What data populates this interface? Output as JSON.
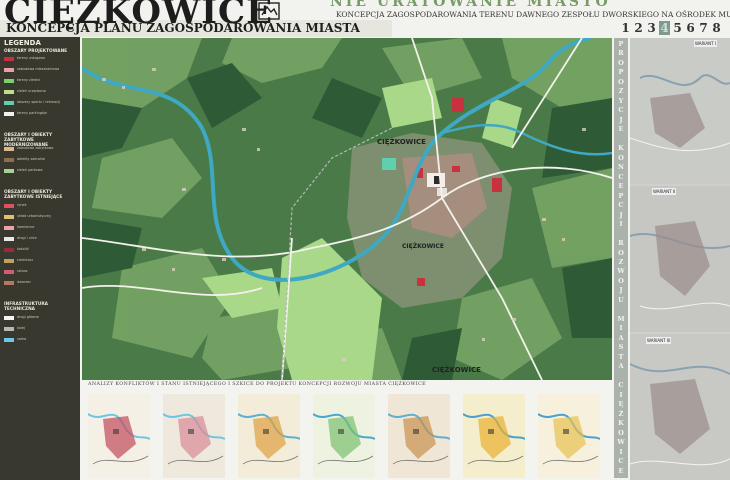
{
  "header": {
    "title": "CIĘŻKOWICE",
    "top_banner": "NIE URATOWANIE MIASTO",
    "concept": "KONCEPCJA ZAGOSPODAROWANIA TERENU DAWNEGO ZESPOŁU DWORSKIEGO NA OŚRODEK MUZYKI",
    "subtitle": "KONCEPCJA PLANU ZAGOSPODAROWANIA MIASTA",
    "pages": [
      "1",
      "2",
      "3",
      "4",
      "5",
      "6",
      "7",
      "8"
    ],
    "active_page": "4"
  },
  "legend": {
    "title": "LEGENDA",
    "sections": [
      {
        "label": "OBSZARY PROJEKTOWANE",
        "rows": [
          {
            "color": "#c8313f",
            "text": "tereny usługowe"
          },
          {
            "color": "#e8a0a8",
            "text": "zabudowa mieszkaniowa"
          },
          {
            "color": "#7bd06e",
            "text": "tereny zieleni"
          },
          {
            "color": "#b9e08f",
            "text": "zieleń urządzona"
          },
          {
            "color": "#5fcfae",
            "text": "obszary sportu i rekreacji"
          },
          {
            "color": "#f0f0f0",
            "text": "tereny parkingów"
          }
        ]
      },
      {
        "label": "OBSZARY I OBIEKTY ZABYTKOWE MODERNIZOWANE",
        "rows": [
          {
            "color": "#d9b98a",
            "text": "zabudowa zabytkowa"
          },
          {
            "color": "#8c6f4f",
            "text": "obiekty sakralne"
          },
          {
            "color": "#a8d090",
            "text": "zieleń parkowa"
          }
        ]
      },
      {
        "label": "OBSZARY I OBIEKTY ZABYTKOWE ISTNIEJĄCE",
        "rows": [
          {
            "color": "#e05060",
            "text": "rynek"
          },
          {
            "color": "#e0c070",
            "text": "układ urbanistyczny"
          },
          {
            "color": "#f0a0a8",
            "text": "kamienice"
          },
          {
            "color": "#e8e8e8",
            "text": "drogi i ulice"
          },
          {
            "color": "#9a2c3a",
            "text": "kościół"
          },
          {
            "color": "#c0a060",
            "text": "cmentarz"
          },
          {
            "color": "#d06070",
            "text": "ratusz"
          },
          {
            "color": "#b07a60",
            "text": "dworzec"
          }
        ]
      },
      {
        "label": "INFRASTRUKTURA TECHNICZNA",
        "rows": [
          {
            "color": "#f4f4f4",
            "text": "drogi główne"
          },
          {
            "color": "#b8b8b8",
            "text": "kolej"
          },
          {
            "color": "#6ec6e6",
            "text": "rzeka"
          }
        ]
      }
    ]
  },
  "map": {
    "labels": [
      "CIĘŻKOWICE",
      "CIĘŻKOWICE",
      "CIĘŻKOWICE"
    ],
    "colors": {
      "forest": "#386a3f",
      "forest_light": "#4c7f4a",
      "field": "#6e9c5e",
      "meadow": "#9fd47f",
      "river": "#3fa8c2",
      "road": "#f2f2ea",
      "urban": "#9e8b78"
    }
  },
  "vertical_text": "PROPOZYCJE KONCEPCJI ROZWOJU MIASTA CIĘŻKOWICE",
  "right_panel": {
    "variants": [
      "WARIANT I",
      "WARIANT II",
      "WARIANT III"
    ]
  },
  "bottom": {
    "analysis": "ANALIZY KONFLIKTÓW I STANU ISTNIEJĄCEGO I SZKICE DO PROJEKTU KONCEPCJI ROZWOJU MIASTA CIĘŻKOWICE",
    "sketch_count": 7
  }
}
